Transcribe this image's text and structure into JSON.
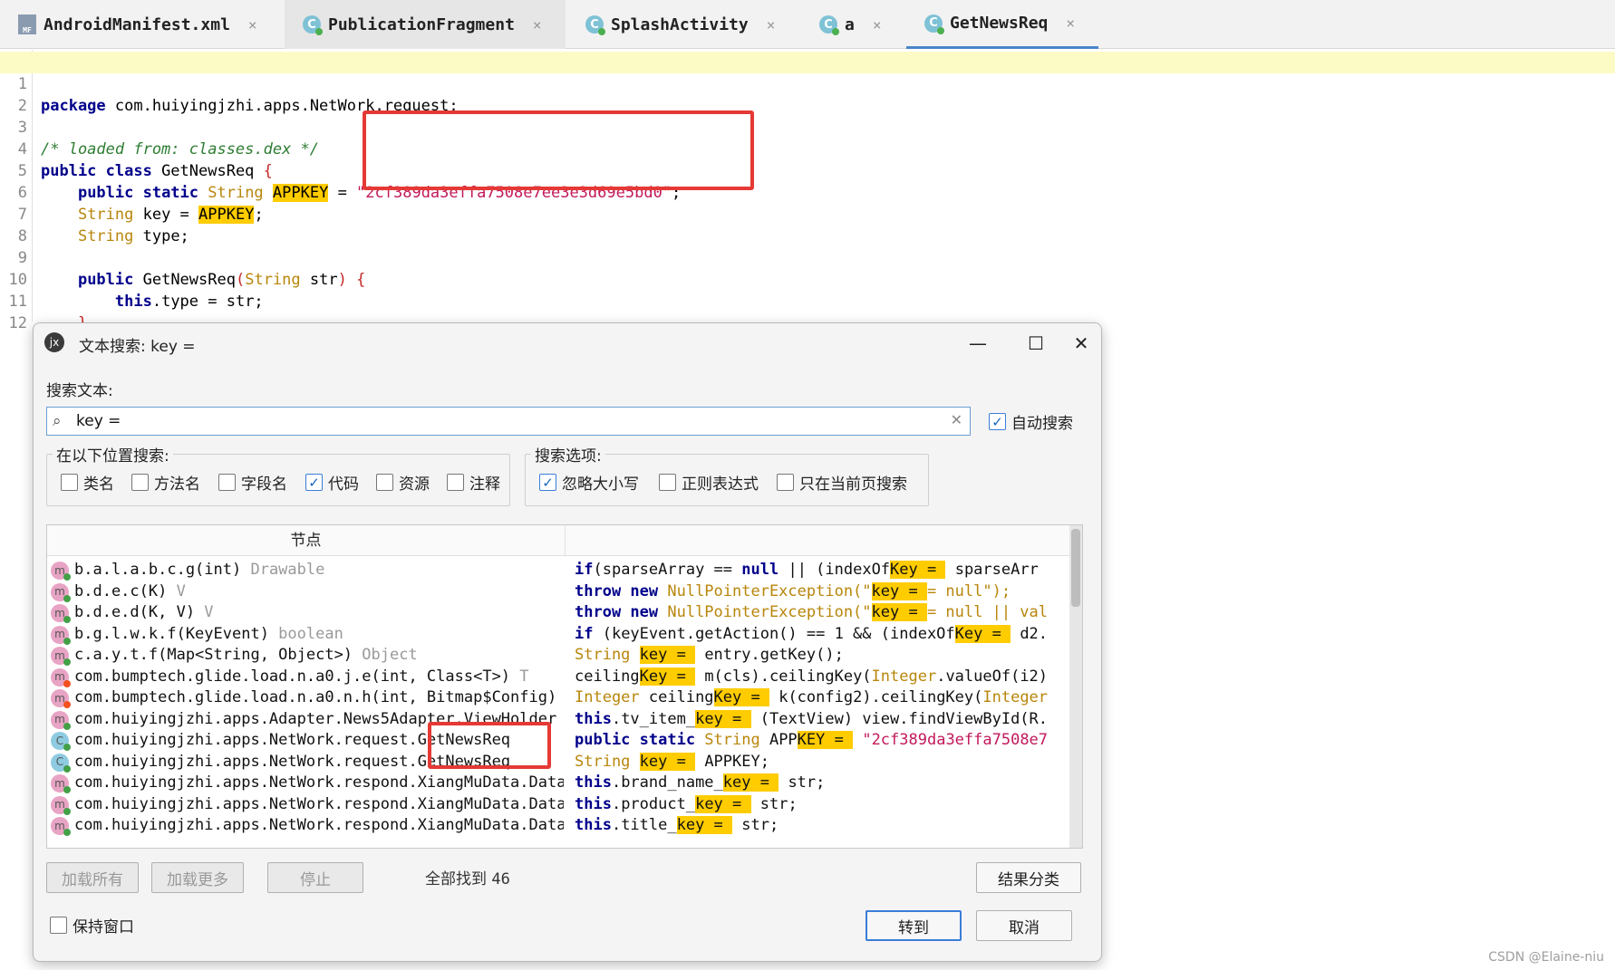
{
  "tabs": [
    {
      "label": "AndroidManifest.xml",
      "icon": "manifest-file-icon",
      "icon_text": "MF"
    },
    {
      "label": "PublicationFragment",
      "icon": "class-icon",
      "icon_text": "C"
    },
    {
      "label": "SplashActivity",
      "icon": "class-icon",
      "icon_text": "C"
    },
    {
      "label": "a",
      "icon": "class-icon",
      "icon_text": "C"
    },
    {
      "label": "GetNewsReq",
      "icon": "class-icon",
      "icon_text": "C"
    }
  ],
  "tab_close_glyph": "×",
  "editor": {
    "line_numbers": [
      "1",
      "2",
      "3",
      "4",
      "5",
      "6",
      "7",
      "8",
      "9",
      "10",
      "11",
      "12"
    ],
    "l1": {
      "kw": "package",
      "rest": " com.huiyingjzhi.apps.NetWork.request;"
    },
    "l3": {
      "comment": "/* loaded from: classes.dex */"
    },
    "l4": {
      "kw": "public class",
      "name": " GetNewsReq ",
      "brace": "{"
    },
    "l5": {
      "indent": "    ",
      "kw": "public static",
      "type": " String ",
      "mark": "APPKEY",
      "eq": " = ",
      "str": "\"2cf389da3effa7508e7ee3e3d69e5bd0\"",
      "semi": ";"
    },
    "l6": {
      "indent": "    ",
      "type": "String",
      "mid": " key = ",
      "mark": "APPKEY",
      "semi": ";"
    },
    "l7": {
      "indent": "    ",
      "type": "String",
      "rest": " type;"
    },
    "l9": {
      "indent": "    ",
      "kw": "public",
      "name": " GetNewsReq",
      "paren": "(",
      "type": "String",
      "rest": " str",
      "paren2": ") {"
    },
    "l10": {
      "indent": "        ",
      "kw": "this",
      "rest": ".type = str;"
    },
    "l11": {
      "indent": "    ",
      "brace": "}"
    },
    "l12": {
      "brace": "}"
    }
  },
  "dialog": {
    "title": "文本搜索: key =",
    "logo_text": "jx",
    "minimize": "—",
    "maximize": "☐",
    "close": "✕",
    "search_label": "搜索文本:",
    "search_value": "key =",
    "search_icon": "search-icon",
    "auto_search": {
      "label": "自动搜索",
      "checked": true
    },
    "scope_group_title": "在以下位置搜索:",
    "scope": [
      {
        "label": "类名",
        "checked": false
      },
      {
        "label": "方法名",
        "checked": false
      },
      {
        "label": "字段名",
        "checked": false
      },
      {
        "label": "代码",
        "checked": true
      },
      {
        "label": "资源",
        "checked": false
      },
      {
        "label": "注释",
        "checked": false
      }
    ],
    "options_group_title": "搜索选项:",
    "options": [
      {
        "label": "忽略大小写",
        "checked": true
      },
      {
        "label": "正则表达式",
        "checked": false
      },
      {
        "label": "只在当前页搜索",
        "checked": false
      }
    ],
    "results_header_node": "节点",
    "results": [
      {
        "icon": "m",
        "kind": "method",
        "node": "b.a.l.a.b.c.g(int)",
        "rtype": " Drawable",
        "snippet_html": [
          [
            "kw",
            "if"
          ],
          [
            "",
            "("
          ],
          [
            "",
            "sparseArray == "
          ],
          [
            "kw",
            "null"
          ],
          [
            "",
            " || (indexOf"
          ],
          [
            "mk",
            "Key = "
          ],
          [
            "",
            " sparseArr"
          ]
        ]
      },
      {
        "icon": "m",
        "kind": "method",
        "node": "b.d.e.c(K)",
        "rtype": " V",
        "snippet_html": [
          [
            "kw",
            "throw new "
          ],
          [
            "ty",
            "NullPointerException(\""
          ],
          [
            "mk",
            "key = "
          ],
          [
            "ty",
            "= null\");"
          ]
        ]
      },
      {
        "icon": "m",
        "kind": "method",
        "node": "b.d.e.d(K, V)",
        "rtype": " V",
        "snippet_html": [
          [
            "kw",
            "throw new "
          ],
          [
            "ty",
            "NullPointerException(\""
          ],
          [
            "mk",
            "key = "
          ],
          [
            "ty",
            "= null || val"
          ]
        ]
      },
      {
        "icon": "m",
        "kind": "method",
        "node": "b.g.l.w.k.f(KeyEvent)",
        "rtype": " boolean",
        "snippet_html": [
          [
            "kw",
            "if"
          ],
          [
            "",
            " (keyEvent.getAction() == 1 && (indexOf"
          ],
          [
            "mk",
            "Key = "
          ],
          [
            "",
            " d2."
          ]
        ]
      },
      {
        "icon": "m",
        "kind": "method",
        "node": "c.a.y.t.f(Map<String, Object>)",
        "rtype": " Object",
        "snippet_html": [
          [
            "ty",
            "String "
          ],
          [
            "mk",
            "key = "
          ],
          [
            "",
            " entry.getKey();"
          ]
        ]
      },
      {
        "icon": "m",
        "kind": "method-lock",
        "node": "com.bumptech.glide.load.n.a0.j.e(int, Class<T>)",
        "rtype": " T",
        "snippet_html": [
          [
            "",
            "ceiling"
          ],
          [
            "mk",
            "Key = "
          ],
          [
            "",
            " m(cls).ceilingKey("
          ],
          [
            "ty",
            "Integer"
          ],
          [
            "",
            ".valueOf(i2)"
          ]
        ]
      },
      {
        "icon": "m",
        "kind": "method-lock",
        "node": "com.bumptech.glide.load.n.a0.n.h(int, Bitmap$Config)",
        "rtype": "",
        "snippet_html": [
          [
            "ty",
            "Integer "
          ],
          [
            "",
            "ceiling"
          ],
          [
            "mk",
            "Key = "
          ],
          [
            "",
            " k(config2).ceilingKey("
          ],
          [
            "ty",
            "Integer"
          ]
        ]
      },
      {
        "icon": "m",
        "kind": "method",
        "node": "com.huiyingjzhi.apps.Adapter.News5Adapter.ViewHolder",
        "rtype": "",
        "snippet_html": [
          [
            "kw",
            "this"
          ],
          [
            "",
            ".tv_item_"
          ],
          [
            "mk",
            "key = "
          ],
          [
            "",
            " (TextView) view.findViewById(R."
          ]
        ]
      },
      {
        "icon": "C",
        "kind": "class",
        "node": "com.huiyingjzhi.apps.NetWork.request.GetNewsReq",
        "rtype": "",
        "snippet_html": [
          [
            "kw",
            "public static "
          ],
          [
            "ty",
            "String "
          ],
          [
            "",
            "APP"
          ],
          [
            "mk",
            "KEY = "
          ],
          [
            "st",
            " \"2cf389da3effa7508e7"
          ]
        ]
      },
      {
        "icon": "C",
        "kind": "class",
        "node": "com.huiyingjzhi.apps.NetWork.request.GetNewsReq",
        "rtype": "",
        "snippet_html": [
          [
            "ty",
            "String "
          ],
          [
            "mk",
            "key = "
          ],
          [
            "",
            " APPKEY;"
          ]
        ]
      },
      {
        "icon": "m",
        "kind": "method",
        "node": "com.huiyingjzhi.apps.NetWork.respond.XiangMuData.Data",
        "rtype": "",
        "snippet_html": [
          [
            "kw",
            "this"
          ],
          [
            "",
            ".brand_name_"
          ],
          [
            "mk",
            "key = "
          ],
          [
            "",
            " str;"
          ]
        ]
      },
      {
        "icon": "m",
        "kind": "method",
        "node": "com.huiyingjzhi.apps.NetWork.respond.XiangMuData.Data",
        "rtype": "",
        "snippet_html": [
          [
            "kw",
            "this"
          ],
          [
            "",
            ".product_"
          ],
          [
            "mk",
            "key = "
          ],
          [
            "",
            " str;"
          ]
        ]
      },
      {
        "icon": "m",
        "kind": "method",
        "node": "com.huiyingjzhi.apps.NetWork.respond.XiangMuData.Data",
        "rtype": "",
        "snippet_html": [
          [
            "kw",
            "this"
          ],
          [
            "",
            ".title_"
          ],
          [
            "mk",
            "key = "
          ],
          [
            "",
            " str;"
          ]
        ]
      }
    ],
    "buttons": {
      "load_all": "加载所有",
      "load_more": "加载更多",
      "stop": "停止",
      "group_results": "结果分类",
      "goto": "转到",
      "cancel": "取消"
    },
    "found_prefix": "全部找到",
    "found_count": "46",
    "keep_window": {
      "label": "保持窗口",
      "checked": false
    }
  },
  "watermark": "CSDN @Elaine-niu",
  "colors": {
    "highlight_line": "#fdfbc5",
    "match_mark": "#ffcc00",
    "red_annotation": "#e53935",
    "accent": "#3b7dd8"
  }
}
